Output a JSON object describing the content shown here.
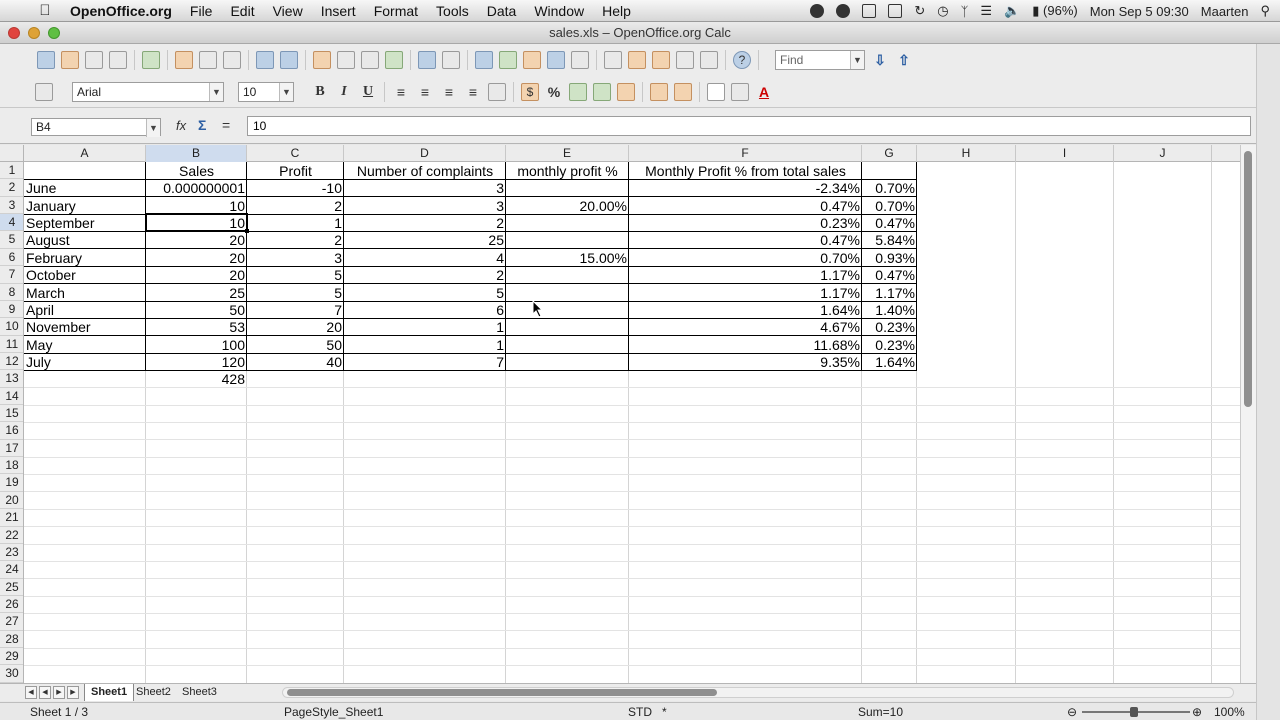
{
  "menubar": {
    "app_name": "OpenOffice.org",
    "menus": [
      "File",
      "Edit",
      "View",
      "Insert",
      "Format",
      "Tools",
      "Data",
      "Window",
      "Help"
    ],
    "battery": "(96%)",
    "clock": "Mon Sep 5  09:30",
    "user": "Maarten"
  },
  "window": {
    "title": "sales.xls – OpenOffice.org Calc"
  },
  "toolbar": {
    "find_placeholder": "Find",
    "font_name": "Arial",
    "font_size": "10"
  },
  "formula": {
    "cell_ref": "B4",
    "content": "10",
    "fx": "fx",
    "sigma": "Σ",
    "equals": "="
  },
  "columns": [
    "A",
    "B",
    "C",
    "D",
    "E",
    "F",
    "G",
    "H",
    "I",
    "J"
  ],
  "rows": [
    "1",
    "2",
    "3",
    "4",
    "5",
    "6",
    "7",
    "8",
    "9",
    "10",
    "11",
    "12",
    "13",
    "14",
    "15",
    "16",
    "17",
    "18",
    "19",
    "20",
    "21",
    "22",
    "23",
    "24",
    "25",
    "26",
    "27",
    "28",
    "29",
    "30"
  ],
  "headers": {
    "b": "Sales",
    "c": "Profit",
    "d": "Number of complaints",
    "e": "monthly profit %",
    "f": "Monthly Profit % from total sales"
  },
  "data_rows": [
    {
      "a": "June",
      "b": "0.000000001",
      "c": "-10",
      "d": "3",
      "e": "",
      "f": "-2.34%",
      "g": "0.70%"
    },
    {
      "a": "January",
      "b": "10",
      "c": "2",
      "d": "3",
      "e": "20.00%",
      "f": "0.47%",
      "g": "0.70%"
    },
    {
      "a": "September",
      "b": "10",
      "c": "1",
      "d": "2",
      "e": "",
      "f": "0.23%",
      "g": "0.47%"
    },
    {
      "a": "August",
      "b": "20",
      "c": "2",
      "d": "25",
      "e": "",
      "f": "0.47%",
      "g": "5.84%"
    },
    {
      "a": "February",
      "b": "20",
      "c": "3",
      "d": "4",
      "e": "15.00%",
      "f": "0.70%",
      "g": "0.93%"
    },
    {
      "a": "October",
      "b": "20",
      "c": "5",
      "d": "2",
      "e": "",
      "f": "1.17%",
      "g": "0.47%"
    },
    {
      "a": "March",
      "b": "25",
      "c": "5",
      "d": "5",
      "e": "",
      "f": "1.17%",
      "g": "1.17%"
    },
    {
      "a": "April",
      "b": "50",
      "c": "7",
      "d": "6",
      "e": "",
      "f": "1.64%",
      "g": "1.40%"
    },
    {
      "a": "November",
      "b": "53",
      "c": "20",
      "d": "1",
      "e": "",
      "f": "4.67%",
      "g": "0.23%"
    },
    {
      "a": "May",
      "b": "100",
      "c": "50",
      "d": "1",
      "e": "",
      "f": "11.68%",
      "g": "0.23%"
    },
    {
      "a": "July",
      "b": "120",
      "c": "40",
      "d": "7",
      "e": "",
      "f": "9.35%",
      "g": "1.64%"
    }
  ],
  "total": {
    "b": "428"
  },
  "sheets": [
    "Sheet1",
    "Sheet2",
    "Sheet3"
  ],
  "status": {
    "sheet": "Sheet 1 / 3",
    "page_style": "PageStyle_Sheet1",
    "mode": "STD",
    "modified": "*",
    "sum": "Sum=10",
    "zoom": "100%"
  }
}
